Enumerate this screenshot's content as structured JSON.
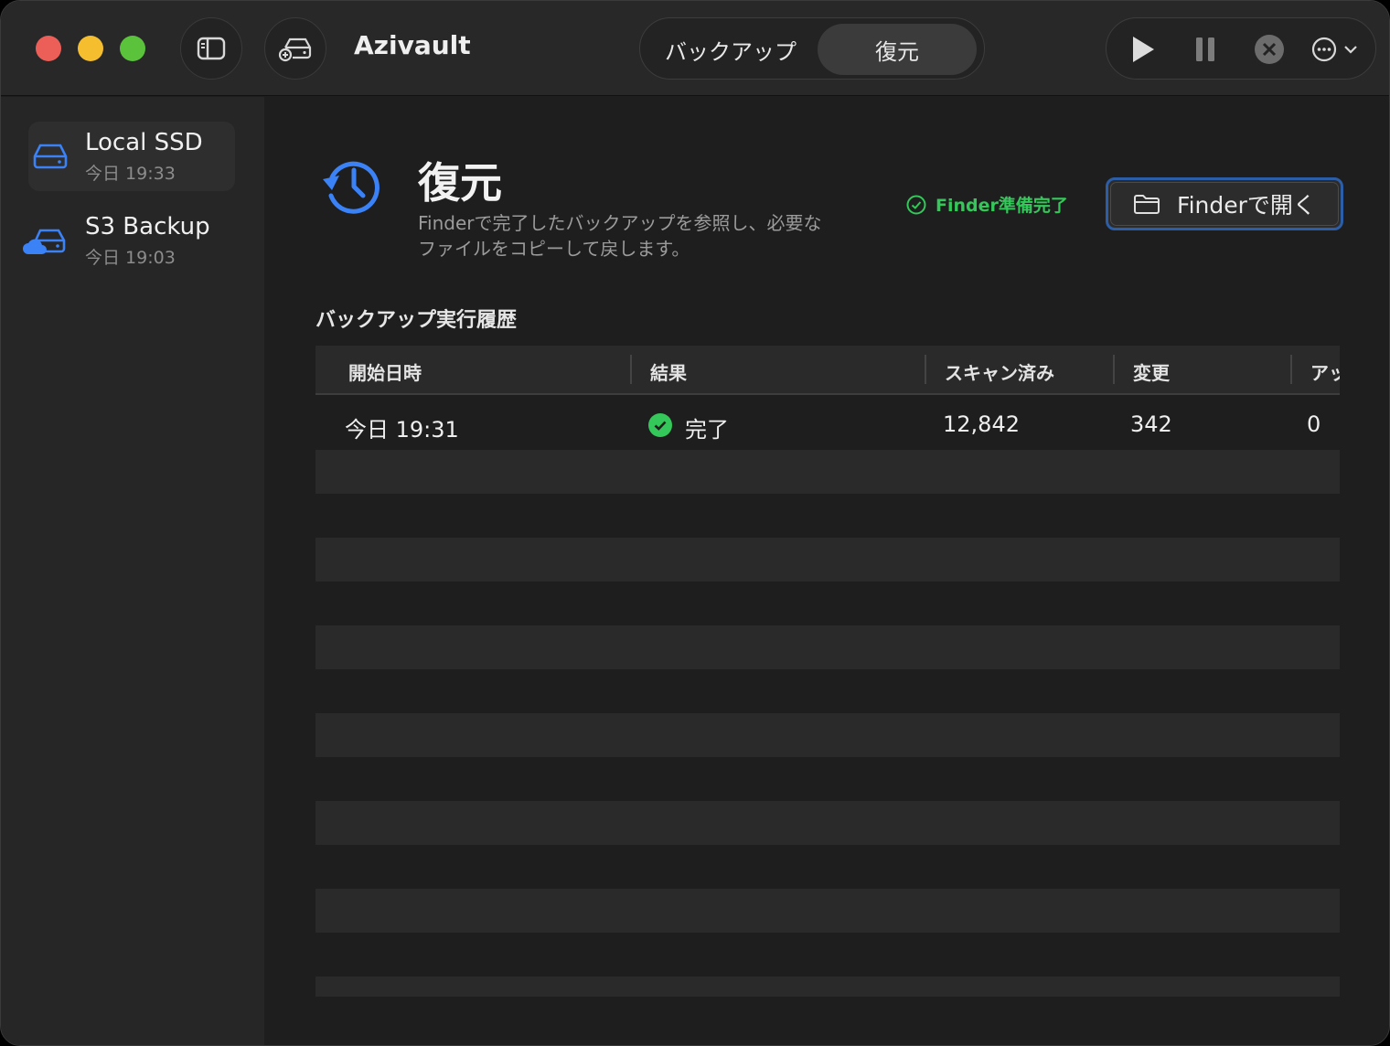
{
  "window": {
    "app_title": "Azivault"
  },
  "segments": {
    "backup": "バックアップ",
    "restore": "復元",
    "selected": "restore"
  },
  "toolbar": {
    "icons": [
      "play-icon",
      "pause-icon",
      "stop-circle-icon",
      "more-menu-icon"
    ]
  },
  "sidebar": {
    "items": [
      {
        "name": "Local SSD",
        "time": "今日 19:33",
        "icon": "drive-icon",
        "selected": true
      },
      {
        "name": "S3 Backup",
        "time": "今日 19:03",
        "icon": "cloud-drive-icon",
        "selected": false
      }
    ]
  },
  "header": {
    "title": "復元",
    "description": "Finderで完了したバックアップを参照し、必要なファイルをコピーして戻します。",
    "status": "Finder準備完了",
    "open_button": "Finderで開く"
  },
  "history": {
    "title": "バックアップ実行履歴",
    "columns": [
      "開始日時",
      "結果",
      "スキャン済み",
      "変更",
      "アッ"
    ],
    "rows": [
      {
        "start": "今日 19:31",
        "result": "完了",
        "scanned": "12,842",
        "changed": "342",
        "uploaded": "0"
      }
    ]
  },
  "colors": {
    "accent": "#3b82f6",
    "success": "#34c759",
    "focus_ring": "#2c5ea8"
  }
}
